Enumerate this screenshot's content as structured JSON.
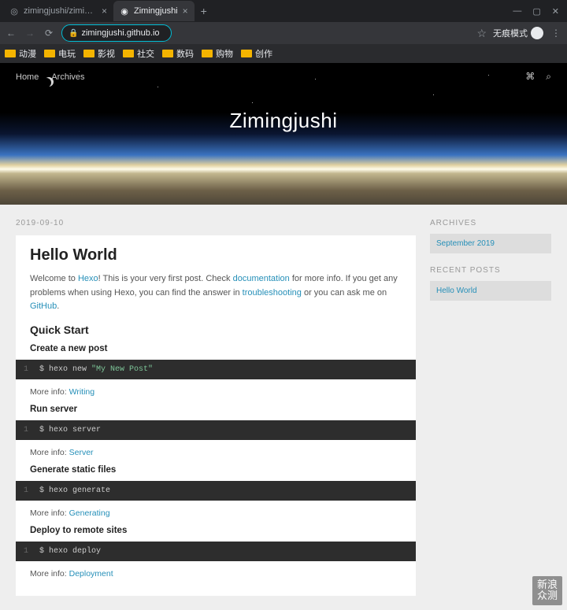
{
  "browser": {
    "tabs": [
      {
        "label": "zimingjushi/zimingjushi.github.i",
        "active": false
      },
      {
        "label": "Zimingjushi",
        "active": true
      }
    ],
    "url": "zimingjushi.github.io",
    "incognito_label": "无痕模式",
    "bookmarks": [
      "动漫",
      "电玩",
      "影视",
      "社交",
      "数码",
      "购物",
      "创作"
    ]
  },
  "page": {
    "nav": {
      "home": "Home",
      "archives": "Archives"
    },
    "hero_title": "Zimingjushi",
    "post": {
      "date": "2019-09-10",
      "title": "Hello World",
      "intro_parts": {
        "t1": "Welcome to ",
        "link_hexo": "Hexo",
        "t2": "! This is your very first post. Check ",
        "link_doc": "documentation",
        "t3": " for more info. If you get any problems when using Hexo, you can find the answer in ",
        "link_trouble": "troubleshooting",
        "t4": " or you can ask me on ",
        "link_github": "GitHub",
        "t5": "."
      },
      "quick_start": "Quick Start",
      "sections": [
        {
          "heading": "Create a new post",
          "cmd_prefix": "$ hexo new ",
          "cmd_str": "\"My New Post\"",
          "more_label": "More info: ",
          "more_link": "Writing"
        },
        {
          "heading": "Run server",
          "cmd_prefix": "$ hexo server",
          "cmd_str": "",
          "more_label": "More info: ",
          "more_link": "Server"
        },
        {
          "heading": "Generate static files",
          "cmd_prefix": "$ hexo generate",
          "cmd_str": "",
          "more_label": "More info: ",
          "more_link": "Generating"
        },
        {
          "heading": "Deploy to remote sites",
          "cmd_prefix": "$ hexo deploy",
          "cmd_str": "",
          "more_label": "More info: ",
          "more_link": "Deployment"
        }
      ]
    },
    "sidebar": {
      "archives_head": "ARCHIVES",
      "archives_item": "September 2019",
      "recent_head": "RECENT POSTS",
      "recent_item": "Hello World"
    }
  },
  "watermark": {
    "line1": "新浪",
    "line2": "众测"
  }
}
